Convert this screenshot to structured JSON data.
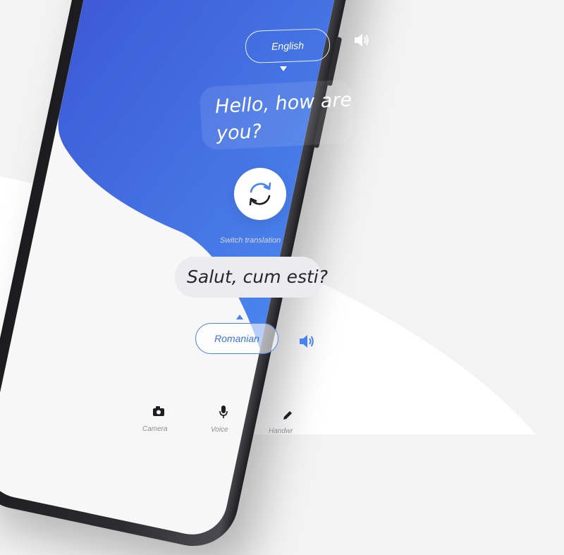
{
  "source_language": {
    "label": "English",
    "text": "Hello, how are you?"
  },
  "target_language": {
    "label": "Romanian",
    "text": "Salut, cum esti?"
  },
  "switch": {
    "label": "Switch translation"
  },
  "bottom_tabs": [
    {
      "label": "Camera",
      "icon": "camera-icon"
    },
    {
      "label": "Voice",
      "icon": "microphone-icon"
    },
    {
      "label": "Handwr",
      "icon": "pencil-icon"
    }
  ],
  "colors": {
    "accent_blue": "#3f6ee8",
    "blue_dark": "#3b4fcf",
    "background": "#f3f3f4",
    "text_dark": "#262630"
  }
}
